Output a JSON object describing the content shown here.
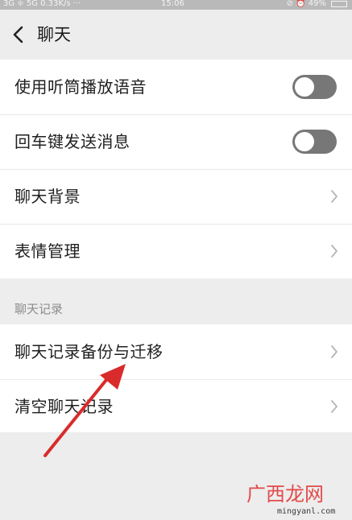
{
  "status_bar": {
    "left_text": "3G ≑ 5G 0.33K/s ···",
    "time": "15:06",
    "right_text": "⊘ ⏰ 49%",
    "battery_level": 0.49,
    "battery_color": "#6fd06f"
  },
  "header": {
    "back_icon": "chevron-left-icon",
    "title": "聊天"
  },
  "settings": {
    "items": [
      {
        "label": "使用听筒播放语音",
        "type": "toggle",
        "on": false
      },
      {
        "label": "回车键发送消息",
        "type": "toggle",
        "on": false
      },
      {
        "label": "聊天背景",
        "type": "link",
        "icon": "chevron-right-icon"
      },
      {
        "label": "表情管理",
        "type": "link",
        "icon": "chevron-right-icon"
      }
    ]
  },
  "chat_history": {
    "section_title": "聊天记录",
    "items": [
      {
        "label": "聊天记录备份与迁移",
        "type": "link",
        "icon": "chevron-right-icon"
      },
      {
        "label": "清空聊天记录",
        "type": "link",
        "icon": "chevron-right-icon"
      }
    ]
  },
  "annotation": {
    "arrow_color": "#d92b2b",
    "points_to": "聊天记录备份与迁移"
  },
  "watermark": {
    "text": "广西龙网",
    "url": "mingyanl.com"
  },
  "colors": {
    "background": "#ededed",
    "card": "#ffffff",
    "toggle_off": "#777777",
    "section_label": "#8c8c8c"
  }
}
